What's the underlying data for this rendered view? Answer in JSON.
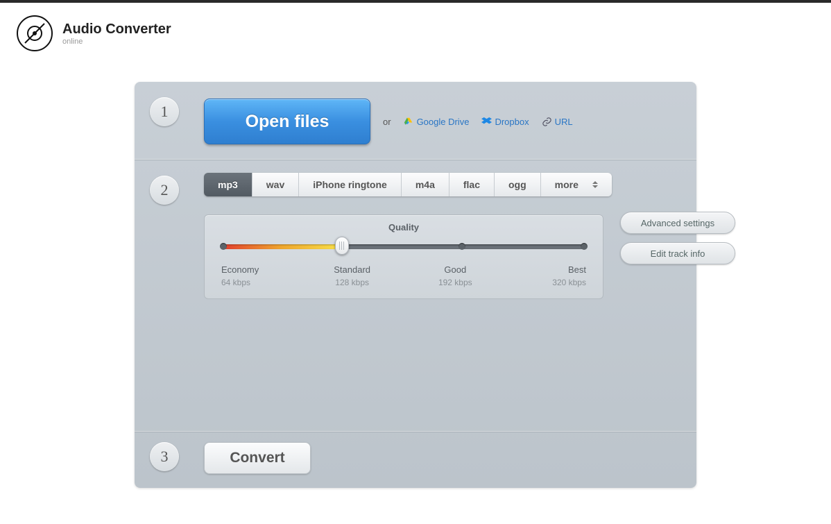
{
  "header": {
    "title": "Audio Converter",
    "subtitle": "online"
  },
  "step1": {
    "badge": "1",
    "open_label": "Open files",
    "or_label": "or",
    "sources": [
      {
        "id": "google-drive",
        "label": "Google Drive"
      },
      {
        "id": "dropbox",
        "label": "Dropbox"
      },
      {
        "id": "url",
        "label": "URL"
      }
    ]
  },
  "step2": {
    "badge": "2",
    "tabs": [
      {
        "id": "mp3",
        "label": "mp3",
        "active": true
      },
      {
        "id": "wav",
        "label": "wav"
      },
      {
        "id": "iphone",
        "label": "iPhone ringtone"
      },
      {
        "id": "m4a",
        "label": "m4a"
      },
      {
        "id": "flac",
        "label": "flac"
      },
      {
        "id": "ogg",
        "label": "ogg"
      },
      {
        "id": "more",
        "label": "more"
      }
    ],
    "quality": {
      "title": "Quality",
      "selected_index": 1,
      "levels": [
        {
          "name": "Economy",
          "bitrate": "64 kbps"
        },
        {
          "name": "Standard",
          "bitrate": "128 kbps"
        },
        {
          "name": "Good",
          "bitrate": "192 kbps"
        },
        {
          "name": "Best",
          "bitrate": "320 kbps"
        }
      ]
    },
    "side_buttons": {
      "advanced": "Advanced settings",
      "edit_info": "Edit track info"
    }
  },
  "step3": {
    "badge": "3",
    "convert_label": "Convert"
  }
}
